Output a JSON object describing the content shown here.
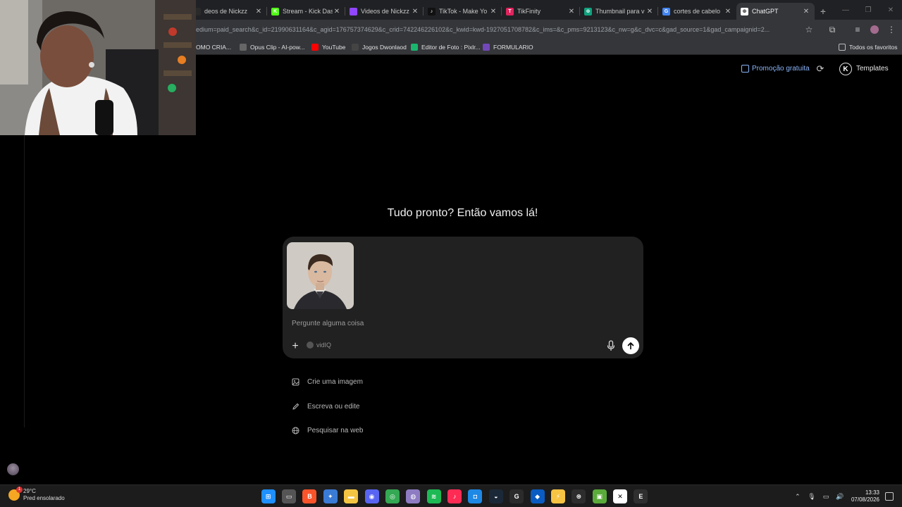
{
  "browser": {
    "tabs": [
      {
        "title": "deos de Nickzz",
        "favicon_color": "#2a2a2a",
        "favicon_glyph": ""
      },
      {
        "title": "Stream - Kick Das",
        "favicon_color": "#53fc18",
        "favicon_glyph": "K"
      },
      {
        "title": "Videos de Nickzz",
        "favicon_color": "#9146ff",
        "favicon_glyph": ""
      },
      {
        "title": "TikTok - Make Yo",
        "favicon_color": "#111111",
        "favicon_glyph": "♪"
      },
      {
        "title": "TikFinity",
        "favicon_color": "#e0245e",
        "favicon_glyph": "T"
      },
      {
        "title": "Thumbnail para v",
        "favicon_color": "#10a37f",
        "favicon_glyph": "⊛"
      },
      {
        "title": "cortes de cabelo",
        "favicon_color": "#4285f4",
        "favicon_glyph": "G"
      },
      {
        "title": "ChatGPT",
        "favicon_color": "#ffffff",
        "favicon_glyph": "⊛",
        "active": true
      }
    ],
    "new_tab_label": "+",
    "url": "edium=paid_search&c_id=21990631164&c_agid=176757374629&c_crid=742246226102&c_kwid=kwd-1927051708782&c_ims=&c_pms=9213123&c_nw=g&c_dvc=c&gad_source=1&gad_campaignid=2...",
    "bookmarks": [
      {
        "label": "OMO CRIA...",
        "color": "#444444"
      },
      {
        "label": "Opus Clip - AI-pow...",
        "color": "#666666"
      },
      {
        "label": "YouTube",
        "color": "#ff0000"
      },
      {
        "label": "Jogos Dwonlaod",
        "color": "#444444"
      },
      {
        "label": "Editor de Foto : Pixlr...",
        "color": "#1bb66e"
      },
      {
        "label": "FORMULARIO",
        "color": "#7248b9"
      }
    ],
    "bookmarks_folder": "Todos os favoritos"
  },
  "chatgpt": {
    "promo_label": "Promoção gratuita",
    "templates_label": "Templates",
    "templates_badge": "K",
    "headline": "Tudo pronto? Então vamos lá!",
    "composer": {
      "placeholder": "Pergunte alguma coisa",
      "tool_label": "vidIQ"
    },
    "suggestions": [
      {
        "label": "Crie uma imagem",
        "icon": "image-icon"
      },
      {
        "label": "Escreva ou edite",
        "icon": "pencil-icon"
      },
      {
        "label": "Pesquisar na web",
        "icon": "globe-icon"
      }
    ]
  },
  "taskbar": {
    "temperature": "29°C",
    "weather_desc": "Pred ensolarado",
    "time": "13:33",
    "date": "07/08/2026",
    "apps": [
      {
        "name": "windows-start",
        "color": "#1e90ff",
        "glyph": "⊞"
      },
      {
        "name": "file-explorer-gray",
        "color": "#555555",
        "glyph": "▭"
      },
      {
        "name": "brave",
        "color": "#fb542b",
        "glyph": "B"
      },
      {
        "name": "copilot",
        "color": "#3a7bd5",
        "glyph": "✦"
      },
      {
        "name": "folder",
        "color": "#f4c542",
        "glyph": "▬"
      },
      {
        "name": "discord",
        "color": "#5865f2",
        "glyph": "◉"
      },
      {
        "name": "chrome",
        "color": "#34a853",
        "glyph": "◎"
      },
      {
        "name": "app-shell",
        "color": "#8e7cc3",
        "glyph": "◍"
      },
      {
        "name": "spotify",
        "color": "#1db954",
        "glyph": "≋"
      },
      {
        "name": "tiktok",
        "color": "#fe2c55",
        "glyph": "♪"
      },
      {
        "name": "app-blue",
        "color": "#1e88e5",
        "glyph": "◘"
      },
      {
        "name": "steam",
        "color": "#1b2838",
        "glyph": "◒"
      },
      {
        "name": "app-g",
        "color": "#2b2b2b",
        "glyph": "G"
      },
      {
        "name": "vpn",
        "color": "#0a5cc2",
        "glyph": "◆"
      },
      {
        "name": "app-yellow",
        "color": "#f6c343",
        "glyph": "⚡"
      },
      {
        "name": "chatgpt-app",
        "color": "#2d2d2d",
        "glyph": "⊛"
      },
      {
        "name": "minecraft",
        "color": "#5bab3a",
        "glyph": "▣"
      },
      {
        "name": "capcut",
        "color": "#ffffff",
        "glyph": "✕"
      },
      {
        "name": "epic-games",
        "color": "#2f2f2f",
        "glyph": "E"
      }
    ]
  }
}
